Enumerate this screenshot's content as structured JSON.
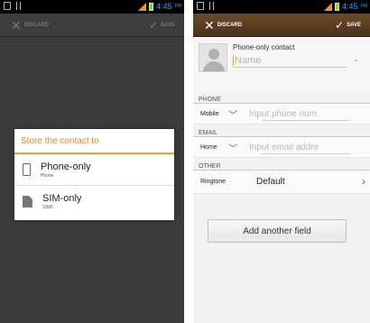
{
  "left_screen": {
    "status_bar": {
      "time": "4:45",
      "ampm": "PM"
    },
    "action_bar": {
      "discard": "DISCARD",
      "save": "SAVE"
    },
    "dialog": {
      "title": "Store the contact to",
      "options": [
        {
          "label": "Phone-only",
          "sublabel": "Phone",
          "icon": "phone-icon"
        },
        {
          "label": "SIM-only",
          "sublabel": "SIM0",
          "icon": "sim-card-icon"
        }
      ]
    }
  },
  "right_screen": {
    "status_bar": {
      "time": "4:45",
      "ampm": "PM"
    },
    "action_bar": {
      "discard": "DISCARD",
      "save": "SAVE"
    },
    "contact": {
      "account_label": "Phone-only contact",
      "name_placeholder": "Name"
    },
    "sections": {
      "phone": {
        "header": "PHONE",
        "type": "Mobile",
        "placeholder": "Input phone num"
      },
      "email": {
        "header": "EMAIL",
        "type": "Home",
        "placeholder": "Input email addre"
      },
      "other": {
        "header": "OTHER",
        "ringtone_label": "Ringtone",
        "ringtone_value": "Default"
      }
    },
    "add_field_button": "Add another field"
  },
  "colors": {
    "accent_orange": "#f0a030",
    "status_time_blue": "#2ba8e0",
    "action_bar_brown": "#5a3d20",
    "dim_background": "#3b3b3b"
  }
}
